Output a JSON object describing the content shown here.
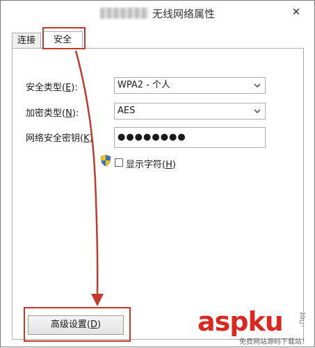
{
  "window": {
    "title": "无线网络属性",
    "close_glyph": "✕"
  },
  "tabs": [
    {
      "label": "连接"
    },
    {
      "label": "安全"
    }
  ],
  "fields": {
    "security_type": {
      "label_main": "安全类型(",
      "label_key": "E",
      "label_end": "):",
      "value": "WPA2 - 个人"
    },
    "encryption_type": {
      "label_main": "加密类型(",
      "label_key": "N",
      "label_end": "):",
      "value": "AES"
    },
    "network_key": {
      "label_main": "网络安全密钥(",
      "label_key": "K",
      "label_end": ")",
      "value": "●●●●●●●●"
    }
  },
  "show_chars": {
    "label_main": "显示字符(",
    "label_key": "H",
    "label_end": ")",
    "checked": false
  },
  "advanced_button": {
    "label_main": "高级设置(",
    "label_key": "D",
    "label_end": ")"
  },
  "watermark": {
    "brand_a": "asp",
    "brand_b": "ku",
    "tld": ".net",
    "tagline": "免费网站源码下载站！"
  },
  "colors": {
    "annotation_red": "#c0392b",
    "watermark_red": "#d9281e"
  },
  "icons": {
    "close": "close-icon",
    "shield": "shield-icon",
    "dropdown": "chevron-down-icon"
  }
}
